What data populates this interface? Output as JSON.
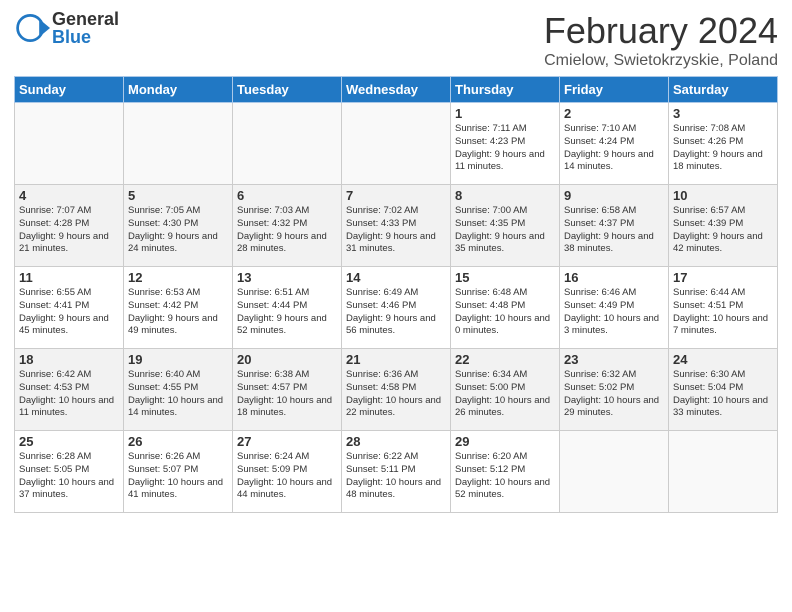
{
  "header": {
    "logo_general": "General",
    "logo_blue": "Blue",
    "month": "February 2024",
    "location": "Cmielow, Swietokrzyskie, Poland"
  },
  "weekdays": [
    "Sunday",
    "Monday",
    "Tuesday",
    "Wednesday",
    "Thursday",
    "Friday",
    "Saturday"
  ],
  "rows": [
    [
      {
        "day": "",
        "info": ""
      },
      {
        "day": "",
        "info": ""
      },
      {
        "day": "",
        "info": ""
      },
      {
        "day": "",
        "info": ""
      },
      {
        "day": "1",
        "info": "Sunrise: 7:11 AM\nSunset: 4:23 PM\nDaylight: 9 hours\nand 11 minutes."
      },
      {
        "day": "2",
        "info": "Sunrise: 7:10 AM\nSunset: 4:24 PM\nDaylight: 9 hours\nand 14 minutes."
      },
      {
        "day": "3",
        "info": "Sunrise: 7:08 AM\nSunset: 4:26 PM\nDaylight: 9 hours\nand 18 minutes."
      }
    ],
    [
      {
        "day": "4",
        "info": "Sunrise: 7:07 AM\nSunset: 4:28 PM\nDaylight: 9 hours\nand 21 minutes."
      },
      {
        "day": "5",
        "info": "Sunrise: 7:05 AM\nSunset: 4:30 PM\nDaylight: 9 hours\nand 24 minutes."
      },
      {
        "day": "6",
        "info": "Sunrise: 7:03 AM\nSunset: 4:32 PM\nDaylight: 9 hours\nand 28 minutes."
      },
      {
        "day": "7",
        "info": "Sunrise: 7:02 AM\nSunset: 4:33 PM\nDaylight: 9 hours\nand 31 minutes."
      },
      {
        "day": "8",
        "info": "Sunrise: 7:00 AM\nSunset: 4:35 PM\nDaylight: 9 hours\nand 35 minutes."
      },
      {
        "day": "9",
        "info": "Sunrise: 6:58 AM\nSunset: 4:37 PM\nDaylight: 9 hours\nand 38 minutes."
      },
      {
        "day": "10",
        "info": "Sunrise: 6:57 AM\nSunset: 4:39 PM\nDaylight: 9 hours\nand 42 minutes."
      }
    ],
    [
      {
        "day": "11",
        "info": "Sunrise: 6:55 AM\nSunset: 4:41 PM\nDaylight: 9 hours\nand 45 minutes."
      },
      {
        "day": "12",
        "info": "Sunrise: 6:53 AM\nSunset: 4:42 PM\nDaylight: 9 hours\nand 49 minutes."
      },
      {
        "day": "13",
        "info": "Sunrise: 6:51 AM\nSunset: 4:44 PM\nDaylight: 9 hours\nand 52 minutes."
      },
      {
        "day": "14",
        "info": "Sunrise: 6:49 AM\nSunset: 4:46 PM\nDaylight: 9 hours\nand 56 minutes."
      },
      {
        "day": "15",
        "info": "Sunrise: 6:48 AM\nSunset: 4:48 PM\nDaylight: 10 hours\nand 0 minutes."
      },
      {
        "day": "16",
        "info": "Sunrise: 6:46 AM\nSunset: 4:49 PM\nDaylight: 10 hours\nand 3 minutes."
      },
      {
        "day": "17",
        "info": "Sunrise: 6:44 AM\nSunset: 4:51 PM\nDaylight: 10 hours\nand 7 minutes."
      }
    ],
    [
      {
        "day": "18",
        "info": "Sunrise: 6:42 AM\nSunset: 4:53 PM\nDaylight: 10 hours\nand 11 minutes."
      },
      {
        "day": "19",
        "info": "Sunrise: 6:40 AM\nSunset: 4:55 PM\nDaylight: 10 hours\nand 14 minutes."
      },
      {
        "day": "20",
        "info": "Sunrise: 6:38 AM\nSunset: 4:57 PM\nDaylight: 10 hours\nand 18 minutes."
      },
      {
        "day": "21",
        "info": "Sunrise: 6:36 AM\nSunset: 4:58 PM\nDaylight: 10 hours\nand 22 minutes."
      },
      {
        "day": "22",
        "info": "Sunrise: 6:34 AM\nSunset: 5:00 PM\nDaylight: 10 hours\nand 26 minutes."
      },
      {
        "day": "23",
        "info": "Sunrise: 6:32 AM\nSunset: 5:02 PM\nDaylight: 10 hours\nand 29 minutes."
      },
      {
        "day": "24",
        "info": "Sunrise: 6:30 AM\nSunset: 5:04 PM\nDaylight: 10 hours\nand 33 minutes."
      }
    ],
    [
      {
        "day": "25",
        "info": "Sunrise: 6:28 AM\nSunset: 5:05 PM\nDaylight: 10 hours\nand 37 minutes."
      },
      {
        "day": "26",
        "info": "Sunrise: 6:26 AM\nSunset: 5:07 PM\nDaylight: 10 hours\nand 41 minutes."
      },
      {
        "day": "27",
        "info": "Sunrise: 6:24 AM\nSunset: 5:09 PM\nDaylight: 10 hours\nand 44 minutes."
      },
      {
        "day": "28",
        "info": "Sunrise: 6:22 AM\nSunset: 5:11 PM\nDaylight: 10 hours\nand 48 minutes."
      },
      {
        "day": "29",
        "info": "Sunrise: 6:20 AM\nSunset: 5:12 PM\nDaylight: 10 hours\nand 52 minutes."
      },
      {
        "day": "",
        "info": ""
      },
      {
        "day": "",
        "info": ""
      }
    ]
  ]
}
